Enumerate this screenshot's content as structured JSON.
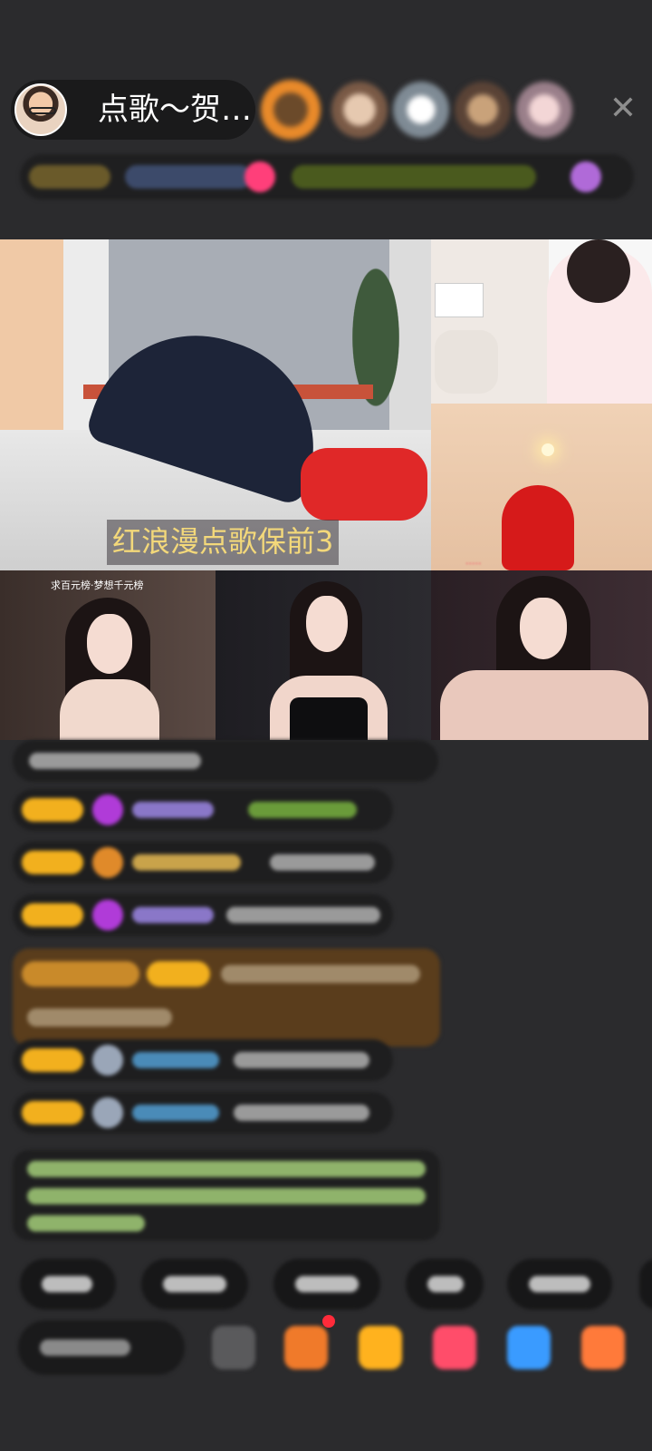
{
  "header": {
    "host_title": "点歌～贺…",
    "close_icon": "close-icon"
  },
  "video": {
    "main_caption": "红浪漫点歌保前3",
    "bottom_left_caption": "求百元榜·梦想千元榜"
  },
  "colors": {
    "background": "#2b2b2d",
    "caption_text": "#f3d87a",
    "badge_gold": "#f2b01e",
    "gift_banner": "#5a3d1c",
    "notice_text": "#8fb36b"
  }
}
